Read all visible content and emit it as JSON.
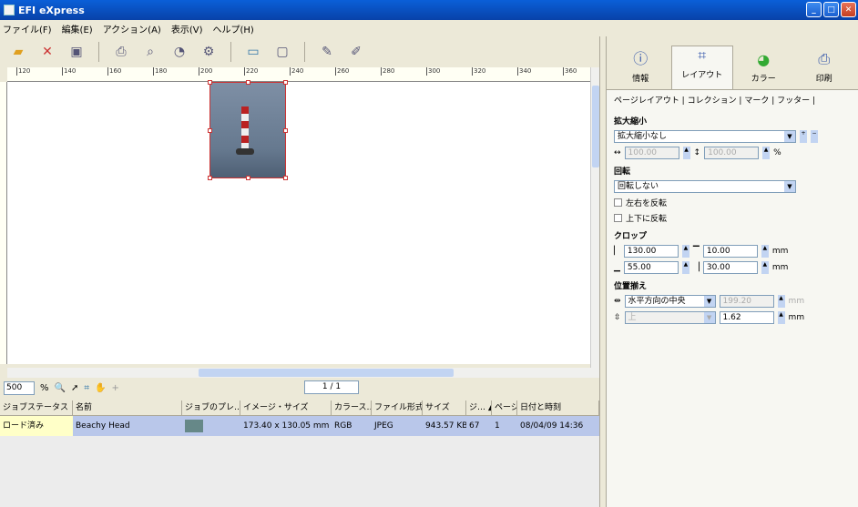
{
  "window": {
    "title": "EFI eXpress"
  },
  "menu": [
    "ファイル(F)",
    "編集(E)",
    "アクション(A)",
    "表示(V)",
    "ヘルプ(H)"
  ],
  "ruler_ticks": [
    "120",
    "140",
    "160",
    "180",
    "200",
    "220",
    "240",
    "260",
    "280",
    "300",
    "320",
    "340",
    "360"
  ],
  "zoom": {
    "value": "500",
    "unit": "%"
  },
  "pager": {
    "text": "1 / 1"
  },
  "table": {
    "headers": [
      "ジョブステータス",
      "名前",
      "ジョブのプレ…",
      "イメージ・サイズ",
      "カラース…",
      "ファイル形式",
      "サイズ",
      "ジ… ▲",
      "ページ",
      "日付と時刻"
    ],
    "rows": [
      [
        "ロード済み",
        "Beachy Head",
        "",
        "173.40 x 130.05 mm",
        "RGB",
        "JPEG",
        "943.57 KB",
        "67",
        "1",
        "08/04/09 14:36"
      ]
    ]
  },
  "right_tabs": [
    {
      "label": "情報",
      "icon": "info-icon"
    },
    {
      "label": "レイアウト",
      "icon": "layout-icon"
    },
    {
      "label": "カラー",
      "icon": "color-icon"
    },
    {
      "label": "印刷",
      "icon": "print-icon"
    }
  ],
  "subtabs": "ページレイアウト | コレクション | マーク | フッター |",
  "layout": {
    "scale_heading": "拡大縮小",
    "scale_value": "拡大縮小なし",
    "width": "100.00",
    "height": "100.00",
    "pct": "%",
    "rotate_heading": "回転",
    "rotate_value": "回転しない",
    "flip_h": "左右を反転",
    "flip_v": "上下に反転",
    "crop_heading": "クロップ",
    "crop_left": "130.00",
    "crop_top": "10.00",
    "crop_bottom": "55.00",
    "crop_right": "30.00",
    "unit": "mm",
    "pos_heading": "位置揃え",
    "align_h": "水平方向の中央",
    "align_h_val": "199.20",
    "align_v": "上",
    "align_v_val": "1.62"
  }
}
